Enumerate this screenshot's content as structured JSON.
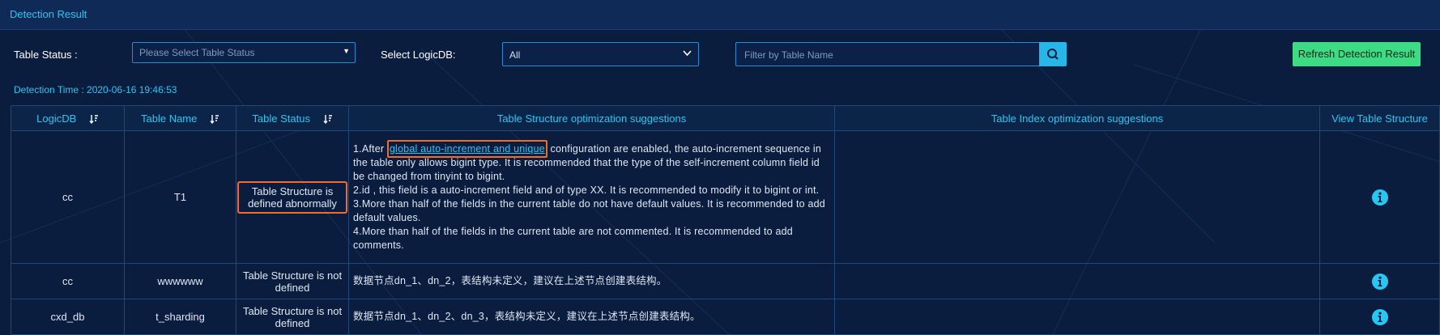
{
  "header": {
    "title": "Detection Result"
  },
  "filters": {
    "table_status_label": "Table Status :",
    "table_status_placeholder": "Please Select Table Status",
    "logicdb_label": "Select LogicDB:",
    "logicdb_value": "All",
    "search_placeholder": "Filter by Table Name",
    "refresh_label": "Refresh Detection Result"
  },
  "detection_time": "Detection Time : 2020-06-16 19:46:53",
  "table": {
    "columns": [
      "LogicDB",
      "Table Name",
      "Table Status",
      "Table Structure optimization suggestions",
      "Table Index optimization suggestions",
      "View Table Structure"
    ],
    "rows": [
      {
        "logicdb": "cc",
        "table_name": "T1",
        "status": "Table Structure is defined abnormally",
        "suggestion_prefix": "1.After ",
        "suggestion_link": "global auto-increment and unique",
        "suggestion_rest": " configuration are enabled, the auto-increment sequence in the table only allows bigint type. It is recommended that the type of the self-increment column field id be changed from tinyint to bigint.",
        "suggestion_lines": [
          "2.id , this field is a auto-increment field and of type XX. It is recommended to modify it to bigint or int.",
          "3.More than half of the fields in the current table do not have default values. It is recommended to add default values.",
          "4.More than half of the fields in the current table are not commented. It is recommended to add comments."
        ],
        "index_suggestion": ""
      },
      {
        "logicdb": "cc",
        "table_name": "wwwwww",
        "status": "Table Structure is not defined",
        "suggestion": "数据节点dn_1、dn_2，表结构未定义，建议在上述节点创建表结构。",
        "index_suggestion": ""
      },
      {
        "logicdb": "cxd_db",
        "table_name": "t_sharding",
        "status": "Table Structure is not defined",
        "suggestion": "数据节点dn_1、dn_2、dn_3，表结构未定义，建议在上述节点创建表结构。",
        "index_suggestion": ""
      }
    ]
  },
  "colors": {
    "accent": "#27c7f2",
    "refresh": "#3ddc84",
    "highlight": "#f26a2c",
    "background": "#0b1d3f"
  },
  "icons": {
    "sort": "sort-desc-icon",
    "info": "info-icon",
    "search": "search-icon",
    "caret": "caret-down-icon",
    "chevron": "chevron-down-icon"
  }
}
